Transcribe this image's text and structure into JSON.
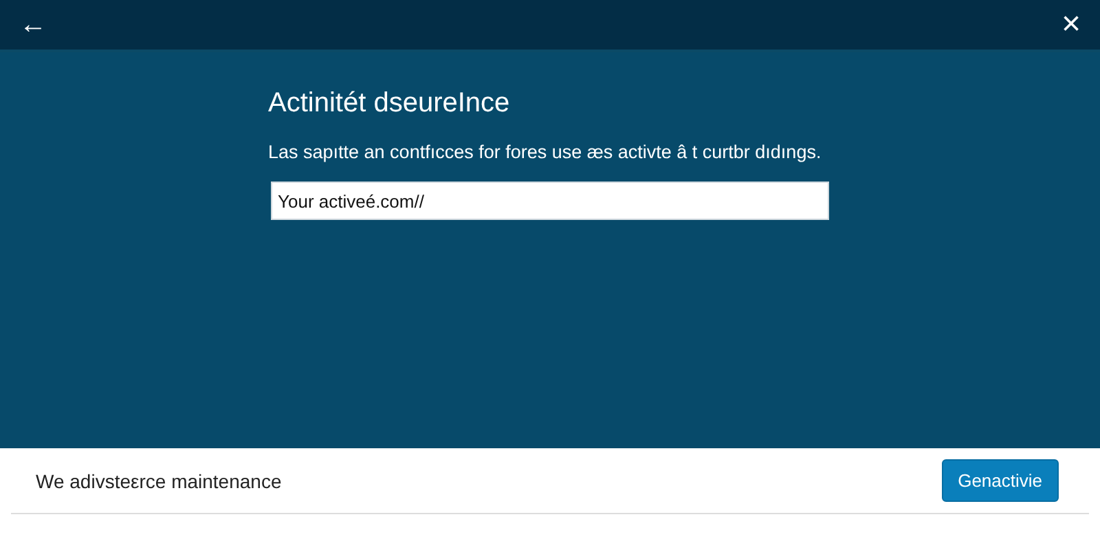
{
  "header": {
    "back": "←",
    "close": "×"
  },
  "dialog": {
    "title": "Actinitét dseureInce",
    "description": "Las sapıtte an contfıcces for fores use æs activte â t curtbr dıdıngs.",
    "field": {
      "value": "Your activeé.com//"
    }
  },
  "footer": {
    "message": "We adivsteεrce maintenance",
    "button": "Genactivie"
  }
}
